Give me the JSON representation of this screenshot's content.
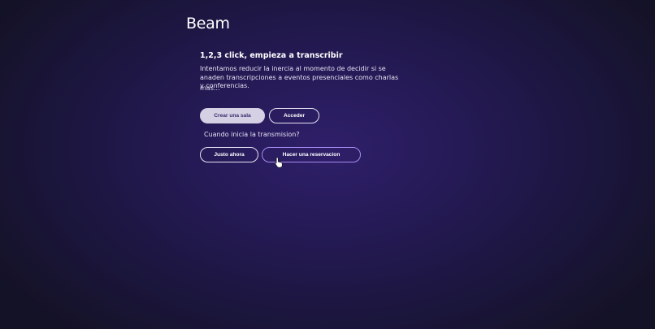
{
  "brand": {
    "title": "Beam"
  },
  "intro": {
    "heading": "1,2,3 click, empieza a transcribir",
    "description": "Intentamos reducir la inercia al momento de decidir si se anaden transcripciones a eventos presenciales como charlas y conferencias.",
    "more_label": "mas..."
  },
  "actions": {
    "create_room_label": "Crear una sala",
    "login_label": "Acceder"
  },
  "schedule": {
    "question": "Cuando inicia la transmision?",
    "now_label": "Justo ahora",
    "reserve_label": "Hacer una reservacion"
  },
  "colors": {
    "background": "#251a55",
    "primary_button": "#d5d0e3",
    "primary_button_text": "#3b2e6e",
    "reserve_border": "#a98bf0"
  },
  "icons": {
    "cursor": "hand-pointer-icon"
  }
}
